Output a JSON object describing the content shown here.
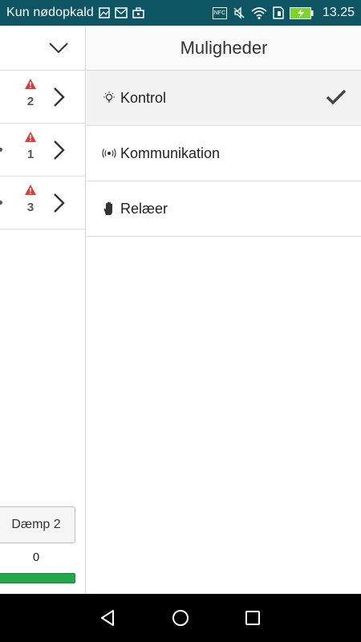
{
  "status_bar": {
    "carrier_text": "Kun nødopkald",
    "time": "13.25",
    "icons": [
      "gallery-icon",
      "mail-icon",
      "briefcase-icon",
      "nfc-icon",
      "mute-icon",
      "wifi-icon",
      "sim-icon",
      "battery-charging-icon"
    ],
    "nfc_label": "NFC",
    "bg_color": "#0d5563"
  },
  "left_panel": {
    "header_icon": "chevron-down-icon",
    "rows": [
      {
        "warning_count": "2"
      },
      {
        "warning_count": "1"
      },
      {
        "warning_count": "3"
      }
    ],
    "damp_button_label": "Dæmp 2",
    "counter_value": "0",
    "bar_color": "#22a84a"
  },
  "options_panel": {
    "title": "Muligheder",
    "options": [
      {
        "label": "Kontrol",
        "icon": "lightbulb-icon",
        "selected": true
      },
      {
        "label": "Kommunikation",
        "icon": "broadcast-icon",
        "selected": false
      },
      {
        "label": "Relæer",
        "icon": "hand-icon",
        "selected": false
      }
    ],
    "selected_icon": "checkmark-icon"
  },
  "nav_bar": {
    "buttons": [
      "back-icon",
      "home-icon",
      "recents-icon"
    ]
  }
}
